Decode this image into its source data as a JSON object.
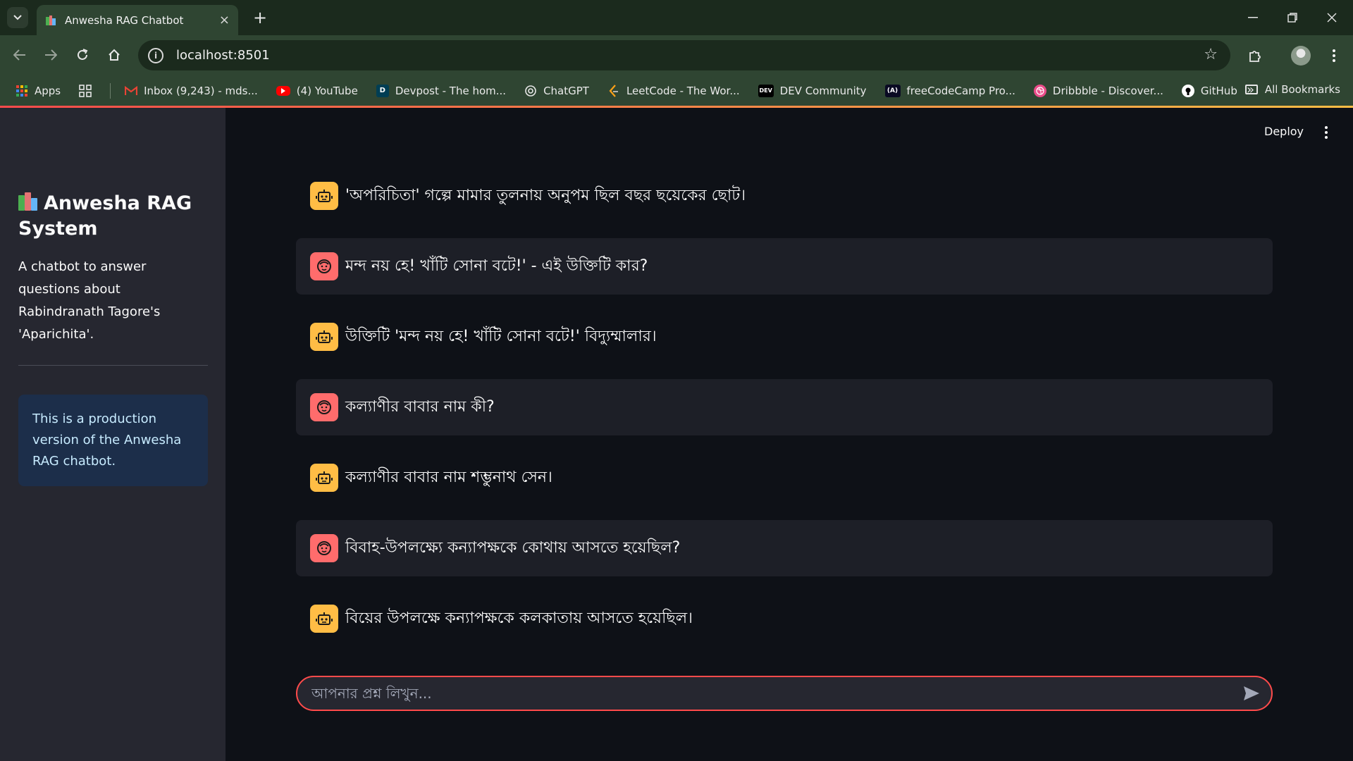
{
  "browser": {
    "tab_title": "Anwesha RAG Chatbot",
    "url": "localhost:8501",
    "new_tab_symbol": "+",
    "bookmarks": [
      {
        "label": "Apps"
      },
      {
        "label": "Inbox (9,243) - mds..."
      },
      {
        "label": "(4) YouTube"
      },
      {
        "label": "Devpost - The hom..."
      },
      {
        "label": "ChatGPT"
      },
      {
        "label": "LeetCode - The Wor..."
      },
      {
        "label": "DEV Community"
      },
      {
        "label": "freeCodeCamp Pro..."
      },
      {
        "label": "Dribbble - Discover..."
      },
      {
        "label": "GitHub"
      }
    ],
    "all_bookmarks": "All Bookmarks",
    "more_symbol": "»"
  },
  "sidebar": {
    "title": "Anwesha RAG System",
    "description": "A chatbot to answer questions about Rabindranath Tagore's 'Aparichita'.",
    "info": "This is a production version of the Anwesha RAG chatbot."
  },
  "header": {
    "deploy_label": "Deploy"
  },
  "messages": [
    {
      "role": "assistant",
      "text": "'অপরিচিতা' গল্পে মামার তুলনায় অনুপম ছিল বছর ছয়েকের ছোট।"
    },
    {
      "role": "user",
      "text": "মন্দ নয় হে! খাঁটি সোনা বটে!' - এই উক্তিটি কার?"
    },
    {
      "role": "assistant",
      "text": "উক্তিটি 'মন্দ নয় হে! খাঁটি সোনা বটে!' বিদ্যুম্মালার।"
    },
    {
      "role": "user",
      "text": "কল্যাণীর বাবার নাম কী?"
    },
    {
      "role": "assistant",
      "text": "কল্যাণীর বাবার নাম শম্ভুনাথ সেন।"
    },
    {
      "role": "user",
      "text": "বিবাহ-উপলক্ষ্যে কন্যাপক্ষকে কোথায় আসতে হয়েছিল?"
    },
    {
      "role": "assistant",
      "text": "বিয়ের উপলক্ষে কন্যাপক্ষকে কলকাতায় আসতে হয়েছিল।"
    }
  ],
  "chat_input": {
    "placeholder": "আপনার প্রশ্ন লিখুন...",
    "value": ""
  },
  "colors": {
    "accent": "#ff4b4b",
    "assistant_avatar": "#ffbd45",
    "user_avatar": "#ff6c6c",
    "sidebar_bg": "#262730",
    "main_bg": "#0e1117",
    "info_bg": "#1c2e4a"
  },
  "icons": {
    "assistant_avatar": "robot-icon",
    "user_avatar": "smiley-face-icon",
    "send": "send-arrow-icon"
  }
}
